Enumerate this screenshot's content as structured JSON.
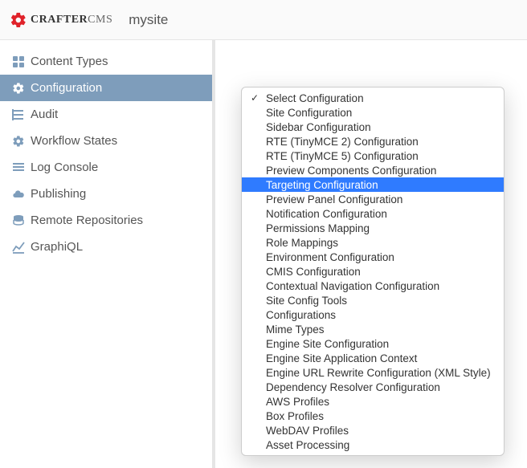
{
  "header": {
    "logo_brand": "CRAFTER",
    "logo_suffix": "CMS",
    "site_name": "mysite"
  },
  "sidebar": {
    "items": [
      {
        "label": "Content Types",
        "icon": "grid-icon"
      },
      {
        "label": "Configuration",
        "icon": "gear-icon"
      },
      {
        "label": "Audit",
        "icon": "list-icon"
      },
      {
        "label": "Workflow States",
        "icon": "gear-icon"
      },
      {
        "label": "Log Console",
        "icon": "lines-icon"
      },
      {
        "label": "Publishing",
        "icon": "cloud-icon"
      },
      {
        "label": "Remote Repositories",
        "icon": "db-icon"
      },
      {
        "label": "GraphiQL",
        "icon": "chart-icon"
      }
    ]
  },
  "dropdown": {
    "options": [
      "Select Configuration",
      "Site Configuration",
      "Sidebar Configuration",
      "RTE (TinyMCE 2) Configuration",
      "RTE (TinyMCE 5) Configuration",
      "Preview Components Configuration",
      "Targeting Configuration",
      "Preview Panel Configuration",
      "Notification Configuration",
      "Permissions Mapping",
      "Role Mappings",
      "Environment Configuration",
      "CMIS Configuration",
      "Contextual Navigation Configuration",
      "Site Config Tools",
      "Configurations",
      "Mime Types",
      "Engine Site Configuration",
      "Engine Site Application Context",
      "Engine URL Rewrite Configuration (XML Style)",
      "Dependency Resolver Configuration",
      "AWS Profiles",
      "Box Profiles",
      "WebDAV Profiles",
      "Asset Processing"
    ],
    "selected": "Select Configuration",
    "highlighted": "Targeting Configuration"
  }
}
